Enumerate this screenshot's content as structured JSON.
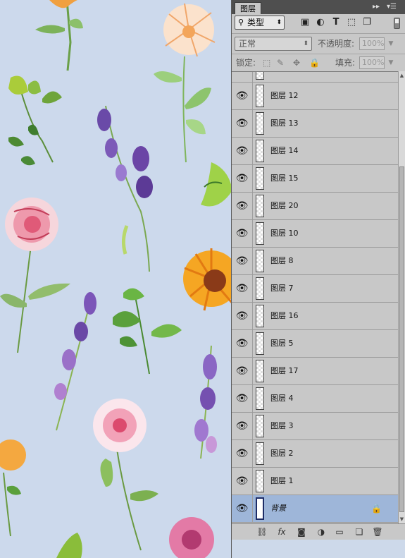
{
  "panel": {
    "tab_label": "图层",
    "collapse_icon": "double-chevron-right",
    "menu_icon": "panel-menu",
    "filter": {
      "label": "类型",
      "icons": [
        "image-filter-icon",
        "adjustment-filter-icon",
        "type-filter-icon",
        "shape-filter-icon",
        "smart-object-filter-icon"
      ]
    },
    "blend_mode": "正常",
    "opacity_label": "不透明度:",
    "opacity_value": "100%",
    "lock_label": "锁定:",
    "fill_label": "填充:",
    "fill_value": "100%"
  },
  "layers": [
    {
      "name": "图层 12"
    },
    {
      "name": "图层 13"
    },
    {
      "name": "图层 14"
    },
    {
      "name": "图层 15"
    },
    {
      "name": "图层 20"
    },
    {
      "name": "图层 10"
    },
    {
      "name": "图层 8"
    },
    {
      "name": "图层 7"
    },
    {
      "name": "图层 16"
    },
    {
      "name": "图层 5"
    },
    {
      "name": "图层 17"
    },
    {
      "name": "图层 4"
    },
    {
      "name": "图层 3"
    },
    {
      "name": "图层 2"
    },
    {
      "name": "图层 1"
    }
  ],
  "background_layer": {
    "name": "背景",
    "locked": true,
    "selected": true
  },
  "bottom_icons": [
    "link-layers-icon",
    "fx-icon",
    "add-mask-icon",
    "adjustment-layer-icon",
    "new-group-icon",
    "new-layer-icon",
    "delete-layer-icon"
  ],
  "colors": {
    "canvas_bg": "#ccd9ec",
    "panel_bg": "#c8c8c8",
    "selected_layer": "#9eb6d9",
    "tab_bar": "#4f4f4f"
  }
}
